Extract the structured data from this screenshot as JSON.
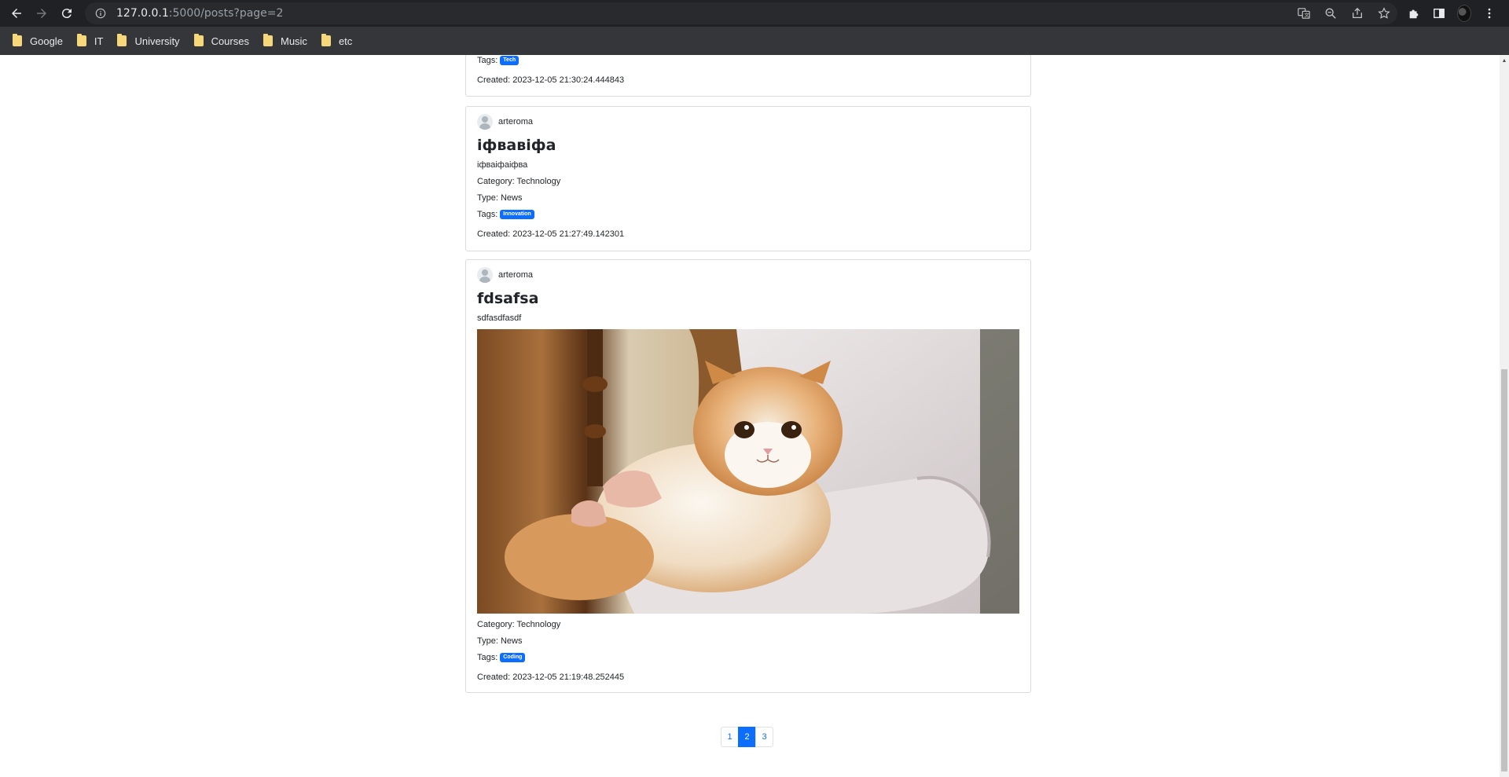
{
  "browser": {
    "url_host": "127.0.0.1",
    "url_path": ":5000/posts?page=2",
    "bookmarks": [
      "Google",
      "IT",
      "University",
      "Courses",
      "Music",
      "etc"
    ]
  },
  "posts": [
    {
      "tags_label": "Tags:",
      "tags": [
        "Tech"
      ],
      "created": "Created: 2023-12-05 21:30:24.444843"
    },
    {
      "author": "arteroma",
      "title": "іфвавіфа",
      "body": "іфваіфаіфва",
      "category": "Category: Technology",
      "type": "Type: News",
      "tags_label": "Tags:",
      "tags": [
        "Innovation"
      ],
      "created": "Created: 2023-12-05 21:27:49.142301"
    },
    {
      "author": "arteroma",
      "title": "fdsafsa",
      "body": "sdfasdfasdf",
      "image": "cat-photo",
      "category": "Category: Technology",
      "type": "Type: News",
      "tags_label": "Tags:",
      "tags": [
        "Coding"
      ],
      "created": "Created: 2023-12-05 21:19:48.252445"
    }
  ],
  "pagination": {
    "pages": [
      "1",
      "2",
      "3"
    ],
    "current": "2"
  },
  "colors": {
    "badge": "#0d6efd",
    "active_page": "#0d6efd"
  }
}
